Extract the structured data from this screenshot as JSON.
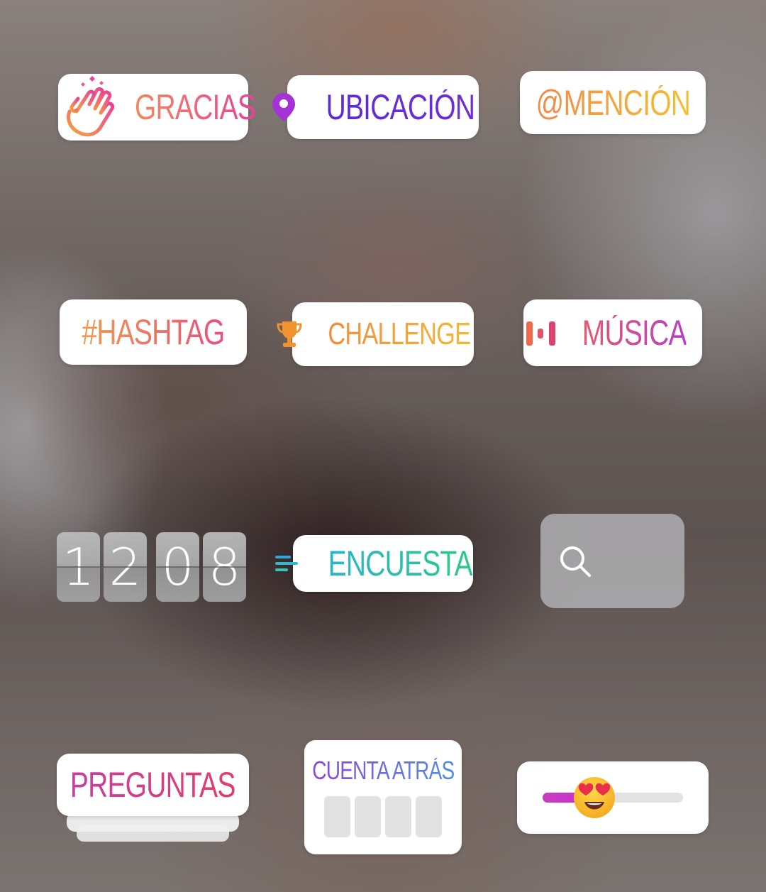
{
  "stickers": {
    "gracias": {
      "label": "GRACIAS",
      "icon": "clapping-hands-icon"
    },
    "ubicacion": {
      "label": "UBICACIÓN",
      "icon": "location-pin-icon"
    },
    "mencion": {
      "label": "@MENCIÓN"
    },
    "hashtag": {
      "label": "#HASHTAG"
    },
    "challenge": {
      "label": "CHALLENGE",
      "icon": "trophy-icon"
    },
    "musica": {
      "label": "MÚSICA",
      "icon": "music-bars-icon"
    },
    "clock": {
      "digits": [
        "1",
        "2",
        "0",
        "8"
      ]
    },
    "encuesta": {
      "label": "ENCUESTA",
      "icon": "poll-lines-icon"
    },
    "search": {
      "icon": "search-icon"
    },
    "preguntas": {
      "label": "PREGUNTAS"
    },
    "cuenta_atras": {
      "label": "CUENTA ATRÁS",
      "boxes": 4
    },
    "slider": {
      "emoji": "heart-eyes-emoji-icon",
      "value": 0.37
    }
  },
  "colors": {
    "gracias": [
      "#f08a5d",
      "#e8429a"
    ],
    "ubicacion": "#5b2bd6",
    "mencion": [
      "#f0894a",
      "#f2c233"
    ],
    "hashtag": [
      "#f39a4c",
      "#e84e7e"
    ],
    "challenge": "#f28d3a",
    "musica": [
      "#e65a6e",
      "#b83fc8"
    ],
    "encuesta": [
      "#27b5c8",
      "#2fc98a"
    ],
    "preguntas": [
      "#c53fa0",
      "#e33c6a"
    ],
    "cuenta": [
      "#8a48d9",
      "#4f8fe3"
    ],
    "slider_fill": "#c43ec0"
  }
}
